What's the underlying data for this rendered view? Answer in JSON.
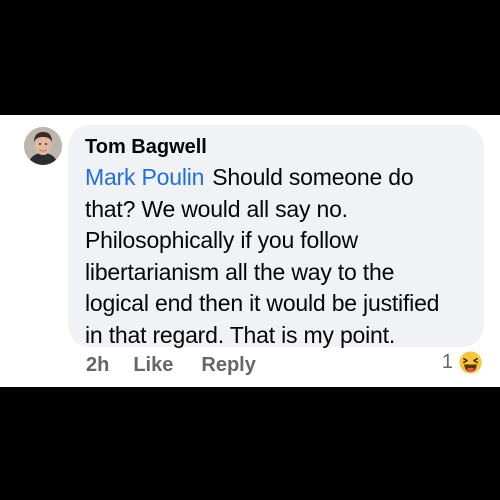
{
  "comment": {
    "author": "Tom Bagwell",
    "mention": "Mark Poulin",
    "lines": [
      "Should someone do",
      "that? We would all say no.",
      "Philosophically if you follow",
      "libertarianism all the way to the",
      "logical end then it would be justified",
      "in that regard. That is my point."
    ],
    "timestamp": "2h",
    "like_label": "Like",
    "reply_label": "Reply",
    "reaction_count": "1",
    "reaction_icon": "haha-emoji-icon"
  },
  "colors": {
    "background": "#000000",
    "bubble": "#f0f2f5",
    "mention": "#216fdb",
    "action_text": "#65676b"
  }
}
